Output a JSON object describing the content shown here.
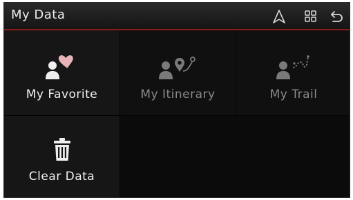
{
  "header": {
    "title": "My Data",
    "nav_icon": "navigation-arrow-icon",
    "menu_icon": "grid-menu-icon",
    "back_icon": "back-arrow-icon"
  },
  "tiles": [
    {
      "label": "My Favorite",
      "icon": "favorite-heart-user-icon",
      "enabled": true
    },
    {
      "label": "My Itinerary",
      "icon": "itinerary-route-icon",
      "enabled": false
    },
    {
      "label": "My Trail",
      "icon": "trail-path-icon",
      "enabled": false
    },
    {
      "label": "Clear Data",
      "icon": "trash-can-icon",
      "enabled": true
    }
  ],
  "colors": {
    "header_accent": "#8b1a1a",
    "favorite_heart": "#e8b3b6",
    "icon_on": "#f0f0f0",
    "icon_off": "#7a7a7a"
  }
}
